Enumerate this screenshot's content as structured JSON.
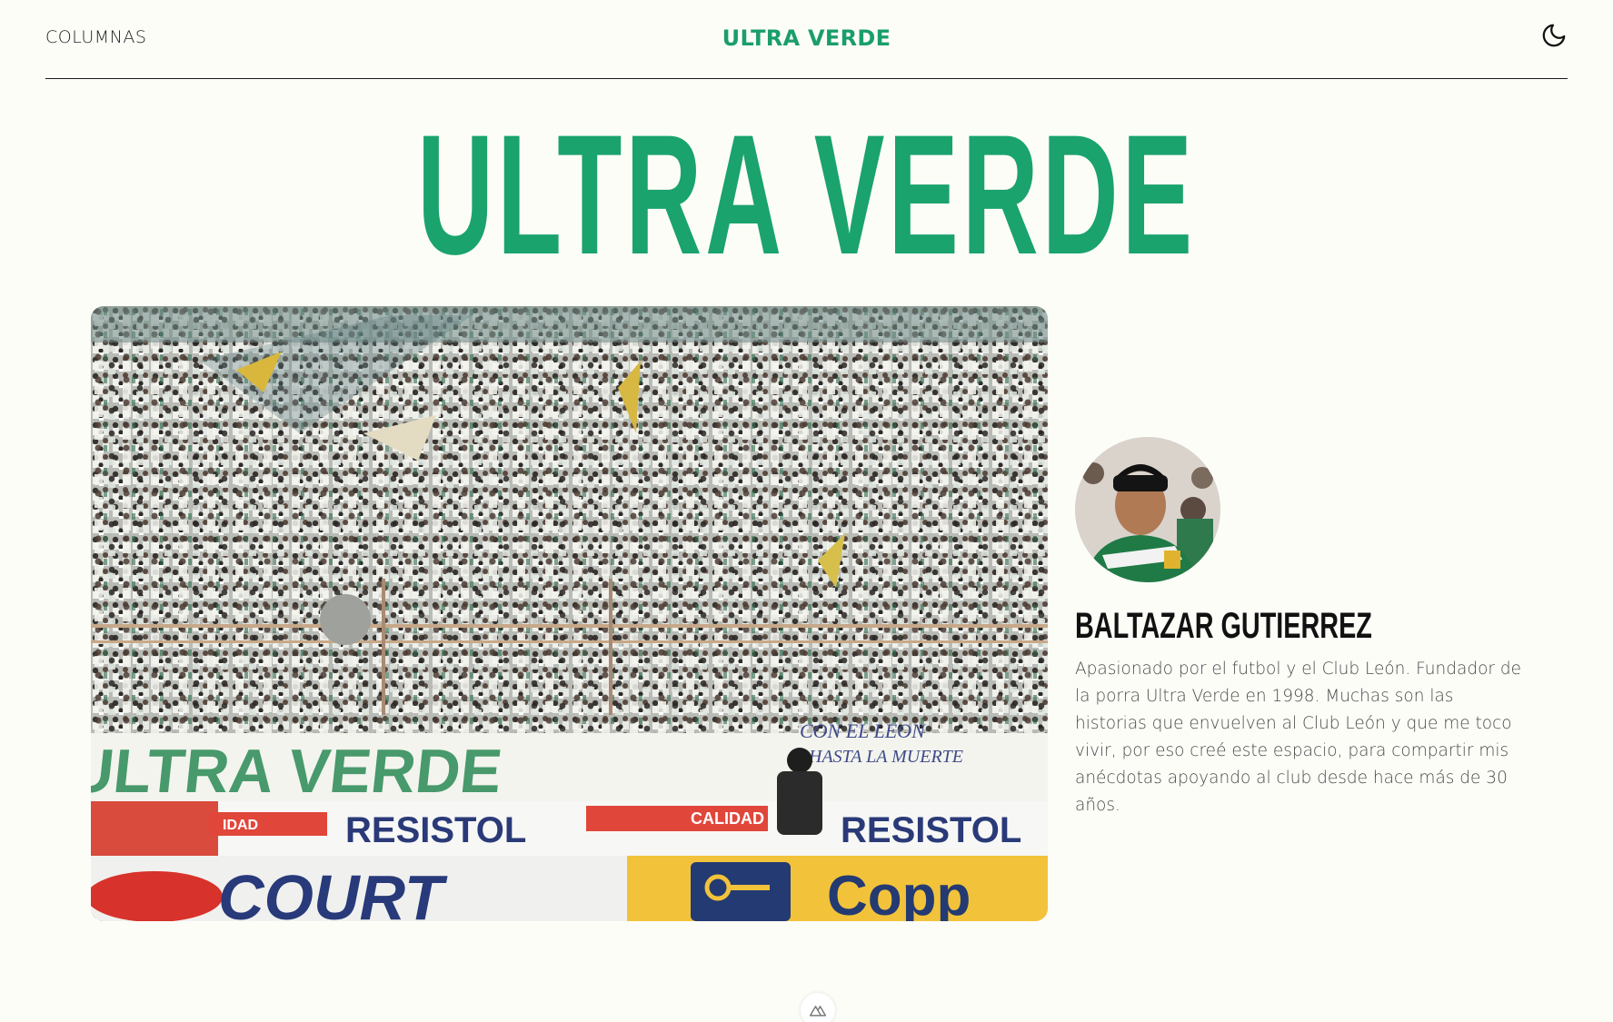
{
  "header": {
    "nav_link": "COLUMNAS",
    "brand": "ULTRA VERDE",
    "theme_icon": "moon-icon"
  },
  "hero": {
    "title": "ULTRA VERDE"
  },
  "photo": {
    "banner_main": "ULTRA VERDE",
    "banner_slogan_1": "CON EL LEON",
    "banner_slogan_2": "HASTA LA MUERTE",
    "sponsor_1": "RESISTOL",
    "sponsor_2": "RESISTOL",
    "sponsor_3": "CALIDAD",
    "sponsor_4": "IDAD",
    "sponsor_5": "COURT",
    "sponsor_6": "Copp"
  },
  "author": {
    "name": "BALTAZAR GUTIERREZ",
    "bio": "Apasionado por el futbol y el Club León. Fundador de la porra Ultra Verde en 1998. Muchas son las historias que envuelven al Club León y que me toco vivir, por eso creé este espacio, para compartir mis anécdotas apoyando al club desde hace más de 30 años."
  },
  "footer": {
    "badge_icon": "nuxt-logo-icon"
  },
  "colors": {
    "brand_green": "#1aa36c",
    "background": "#fdfdf8",
    "text": "#1a1a1a",
    "bio_text": "#4a4a4a"
  }
}
